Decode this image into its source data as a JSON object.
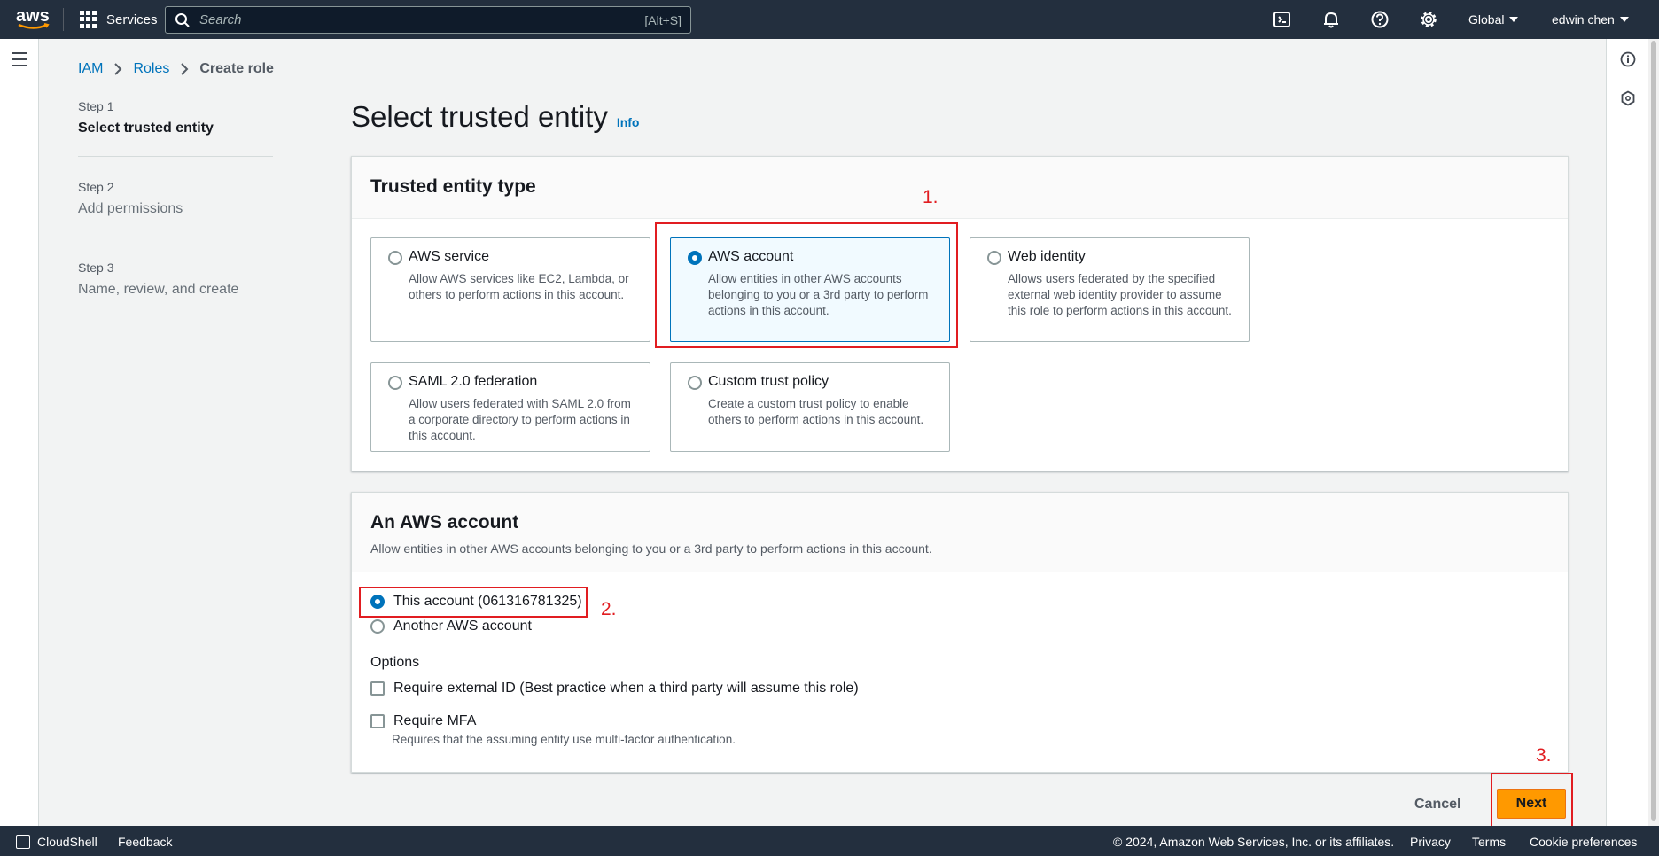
{
  "topnav": {
    "logo_text": "aws",
    "services_label": "Services",
    "search_placeholder": "Search",
    "search_shortcut": "[Alt+S]",
    "region": "Global",
    "user": "edwin chen"
  },
  "breadcrumb": {
    "items": [
      "IAM",
      "Roles"
    ],
    "current": "Create role"
  },
  "steps": [
    {
      "number": "Step 1",
      "title": "Select trusted entity",
      "active": true
    },
    {
      "number": "Step 2",
      "title": "Add permissions",
      "active": false
    },
    {
      "number": "Step 3",
      "title": "Name, review, and create",
      "active": false
    }
  ],
  "page": {
    "title": "Select trusted entity",
    "info_link": "Info"
  },
  "trusted_entity": {
    "heading": "Trusted entity type",
    "options": [
      {
        "title": "AWS service",
        "description": "Allow AWS services like EC2, Lambda, or others to perform actions in this account.",
        "selected": false
      },
      {
        "title": "AWS account",
        "description": "Allow entities in other AWS accounts belonging to you or a 3rd party to perform actions in this account.",
        "selected": true
      },
      {
        "title": "Web identity",
        "description": "Allows users federated by the specified external web identity provider to assume this role to perform actions in this account.",
        "selected": false
      },
      {
        "title": "SAML 2.0 federation",
        "description": "Allow users federated with SAML 2.0 from a corporate directory to perform actions in this account.",
        "selected": false
      },
      {
        "title": "Custom trust policy",
        "description": "Create a custom trust policy to enable others to perform actions in this account.",
        "selected": false
      }
    ]
  },
  "aws_account": {
    "heading": "An AWS account",
    "description": "Allow entities in other AWS accounts belonging to you or a 3rd party to perform actions in this account.",
    "this_account": "This account (061316781325)",
    "another_account": "Another AWS account",
    "options_label": "Options",
    "require_external_id": "Require external ID (Best practice when a third party will assume this role)",
    "require_mfa": "Require MFA",
    "require_mfa_desc": "Requires that the assuming entity use multi-factor authentication."
  },
  "annotations": [
    "1.",
    "2.",
    "3."
  ],
  "actions": {
    "cancel": "Cancel",
    "next": "Next"
  },
  "footer": {
    "cloudshell": "CloudShell",
    "feedback": "Feedback",
    "copyright": "© 2024, Amazon Web Services, Inc. or its affiliates.",
    "privacy": "Privacy",
    "terms": "Terms",
    "cookie": "Cookie preferences"
  },
  "colors": {
    "nav_bg": "#232f3e",
    "link": "#0073bb",
    "primary_button": "#ff9900",
    "annotation": "#e11d21"
  }
}
